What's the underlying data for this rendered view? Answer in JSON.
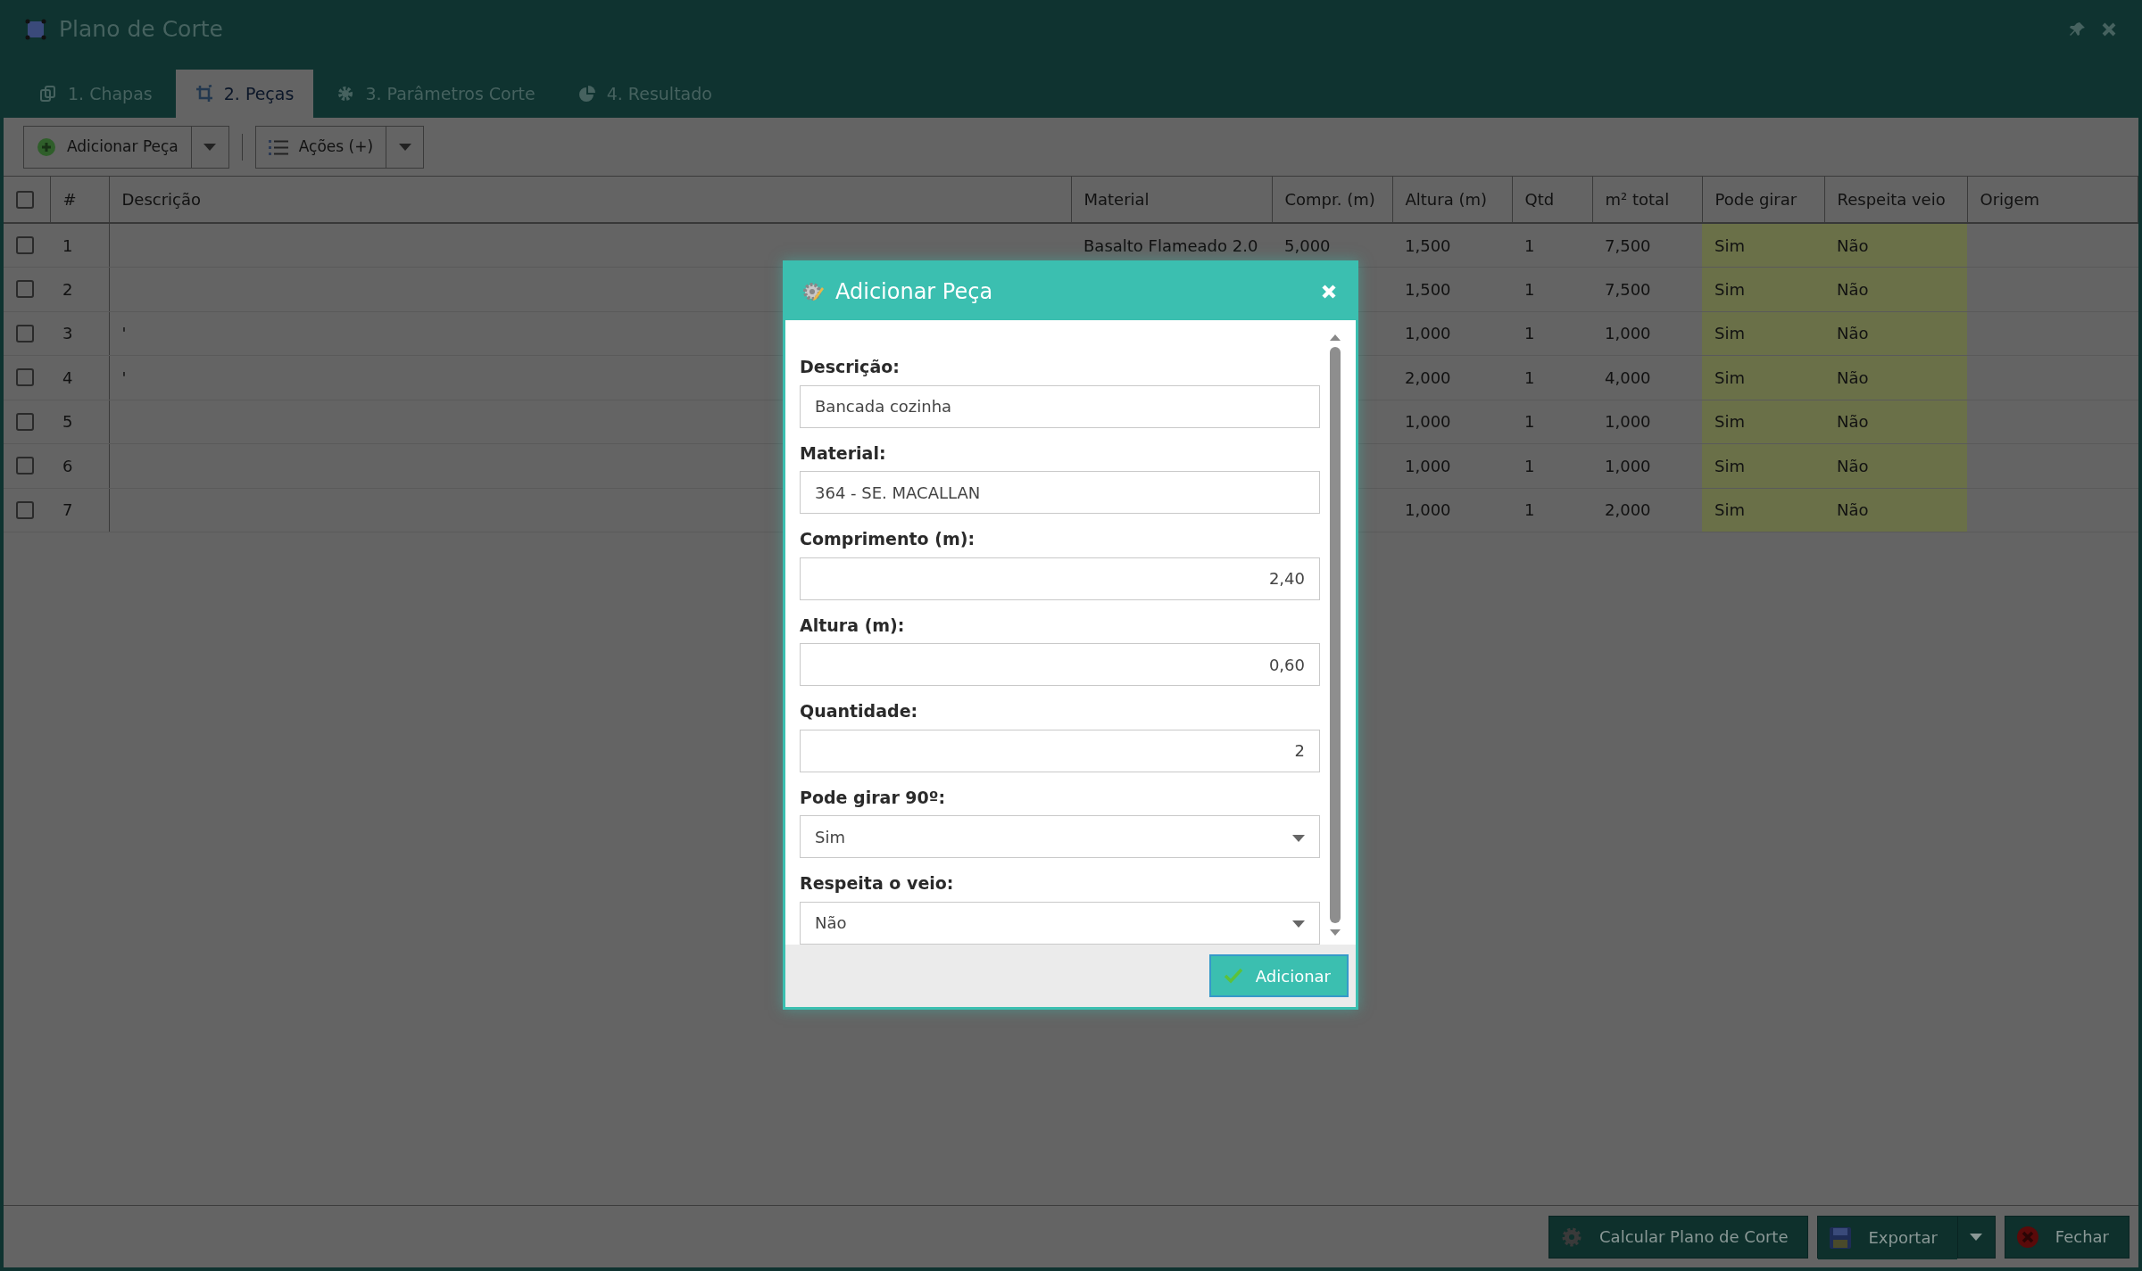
{
  "window": {
    "title": "Plano de Corte"
  },
  "tabs": [
    {
      "label": "1. Chapas",
      "selected": false
    },
    {
      "label": "2. Peças",
      "selected": true
    },
    {
      "label": "3. Parâmetros Corte",
      "selected": false
    },
    {
      "label": "4. Resultado",
      "selected": false
    }
  ],
  "toolbar": [
    {
      "label": "Adicionar Peça"
    },
    {
      "label": "Ações (+)"
    }
  ],
  "table": {
    "select_all": {
      "checked": false
    },
    "columns": [
      {
        "label": "#",
        "highlighted": false
      },
      {
        "label": "Descrição",
        "highlighted": false
      },
      {
        "label": "Material",
        "highlighted": false
      },
      {
        "label": "Compr. (m)",
        "highlighted": false
      },
      {
        "label": "Altura (m)",
        "highlighted": false
      },
      {
        "label": "Qtd",
        "highlighted": false
      },
      {
        "label": "m² total",
        "highlighted": false
      },
      {
        "label": "Pode girar",
        "highlighted": true
      },
      {
        "label": "Respeita veio",
        "highlighted": true
      },
      {
        "label": "Origem",
        "highlighted": false
      }
    ],
    "rows": [
      {
        "checked": false,
        "cells": [
          "1",
          null,
          "Basalto Flameado 2.0",
          "5,000",
          "1,500",
          "1",
          "7,500",
          "Sim",
          "Não",
          null
        ]
      },
      {
        "checked": false,
        "cells": [
          "2",
          null,
          null,
          null,
          "1,500",
          "1",
          "7,500",
          "Sim",
          "Não",
          null
        ]
      },
      {
        "checked": false,
        "cells": [
          "3",
          "'",
          null,
          null,
          "1,000",
          "1",
          "1,000",
          "Sim",
          "Não",
          null
        ]
      },
      {
        "checked": false,
        "cells": [
          "4",
          "'",
          null,
          null,
          "2,000",
          "1",
          "4,000",
          "Sim",
          "Não",
          null
        ]
      },
      {
        "checked": false,
        "cells": [
          "5",
          null,
          null,
          null,
          "1,000",
          "1",
          "1,000",
          "Sim",
          "Não",
          null
        ]
      },
      {
        "checked": false,
        "cells": [
          "6",
          null,
          null,
          null,
          "1,000",
          "1",
          "1,000",
          "Sim",
          "Não",
          null
        ]
      },
      {
        "checked": false,
        "cells": [
          "7",
          null,
          null,
          null,
          "1,000",
          "1",
          "2,000",
          "Sim",
          "Não",
          null
        ]
      }
    ]
  },
  "dialog": {
    "title": "Adicionar Peça",
    "fields": [
      {
        "label": "Descrição:",
        "value": "Bancada cozinha",
        "kind": "text"
      },
      {
        "label": "Material:",
        "value": "364 - SE. MACALLAN",
        "kind": "text"
      },
      {
        "label": "Comprimento (m):",
        "value": "2,40",
        "kind": "number"
      },
      {
        "label": "Altura (m):",
        "value": "0,60",
        "kind": "number"
      },
      {
        "label": "Quantidade:",
        "value": "2",
        "kind": "number"
      },
      {
        "label": "Pode girar 90º:",
        "value": "Sim",
        "kind": "select"
      },
      {
        "label": "Respeita o veio:",
        "value": "Não",
        "kind": "select"
      }
    ],
    "buttons": [
      {
        "label": "Adicionar"
      }
    ]
  },
  "footer": {
    "buttons": [
      {
        "label": "Calcular Plano de Corte",
        "kind": "gear",
        "split": false
      },
      {
        "label": "Exportar",
        "kind": "save",
        "split": true
      },
      {
        "label": "Fechar",
        "kind": "close",
        "split": false
      }
    ]
  }
}
